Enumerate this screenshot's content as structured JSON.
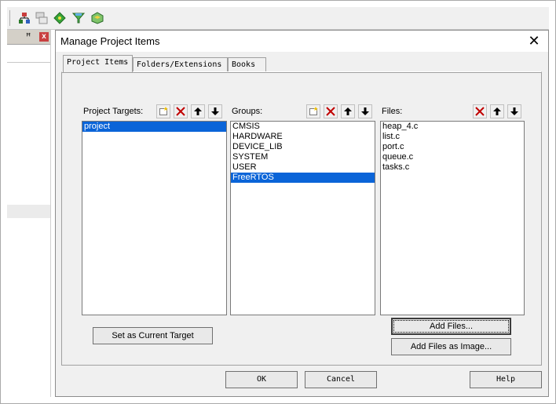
{
  "toolbar": {
    "icons": [
      "project-tree-icon",
      "stacked-windows-icon",
      "green-diamond-icon",
      "funnel-icon",
      "package-icon"
    ]
  },
  "left_pane": {
    "pin": "ꟸ",
    "close": "x"
  },
  "dialog": {
    "title": "Manage Project Items",
    "close_glyph": "✕",
    "tabs": [
      {
        "label": "Project Items",
        "active": true
      },
      {
        "label": "Folders/Extensions",
        "active": false
      },
      {
        "label": "Books",
        "active": false
      }
    ],
    "targets": {
      "label": "Project Targets:",
      "items": [
        "project"
      ],
      "selected": 0
    },
    "groups": {
      "label": "Groups:",
      "items": [
        "CMSIS",
        "HARDWARE",
        "DEVICE_LIB",
        "SYSTEM",
        "USER",
        "FreeRTOS"
      ],
      "selected": 5
    },
    "files": {
      "label": "Files:",
      "items": [
        "heap_4.c",
        "list.c",
        "port.c",
        "queue.c",
        "tasks.c"
      ]
    },
    "buttons": {
      "set_current": "Set as Current Target",
      "add_files": "Add Files...",
      "add_files_image": "Add Files as Image...",
      "ok": "OK",
      "cancel": "Cancel",
      "help": "Help"
    }
  },
  "colors": {
    "selection": "#0a64d8",
    "delete_x": "#c00000"
  }
}
